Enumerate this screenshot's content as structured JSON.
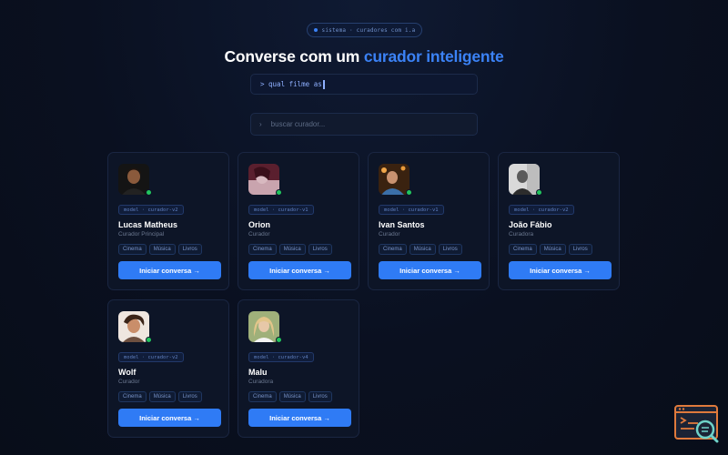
{
  "header": {
    "badge": "sistema · curadores com i.a",
    "title_main": "Converse com um ",
    "title_accent": "curador inteligente"
  },
  "prompt": {
    "text": "> qual filme as"
  },
  "search": {
    "chevron": "›",
    "placeholder": "buscar curador..."
  },
  "colors": {
    "accent": "#3b82f6",
    "button": "#2f7bf5",
    "online": "#22c55e"
  },
  "curators": [
    {
      "model": "model · curador-v2",
      "name": "Lucas Matheus",
      "role": "Curador Principal",
      "tags": [
        "Cinema",
        "Música",
        "Livros"
      ],
      "cta": "Iniciar conversa →"
    },
    {
      "model": "model · curador-v1",
      "name": "Orion",
      "role": "Curador",
      "tags": [
        "Cinema",
        "Música",
        "Livros"
      ],
      "cta": "Iniciar conversa →"
    },
    {
      "model": "model · curador-v1",
      "name": "Ivan Santos",
      "role": "Curador",
      "tags": [
        "Cinema",
        "Música",
        "Livros"
      ],
      "cta": "Iniciar conversa →"
    },
    {
      "model": "model · curador-v2",
      "name": "João Fábio",
      "role": "Curadora",
      "tags": [
        "Cinema",
        "Música",
        "Livros"
      ],
      "cta": "Iniciar conversa →"
    },
    {
      "model": "model · curador-v2",
      "name": "Wolf",
      "role": "Curador",
      "tags": [
        "Cinema",
        "Música",
        "Livros"
      ],
      "cta": "Iniciar conversa →"
    },
    {
      "model": "model · curador-v4",
      "name": "Malu",
      "role": "Curadora",
      "tags": [
        "Cinema",
        "Música",
        "Livros"
      ],
      "cta": "Iniciar conversa →"
    }
  ]
}
